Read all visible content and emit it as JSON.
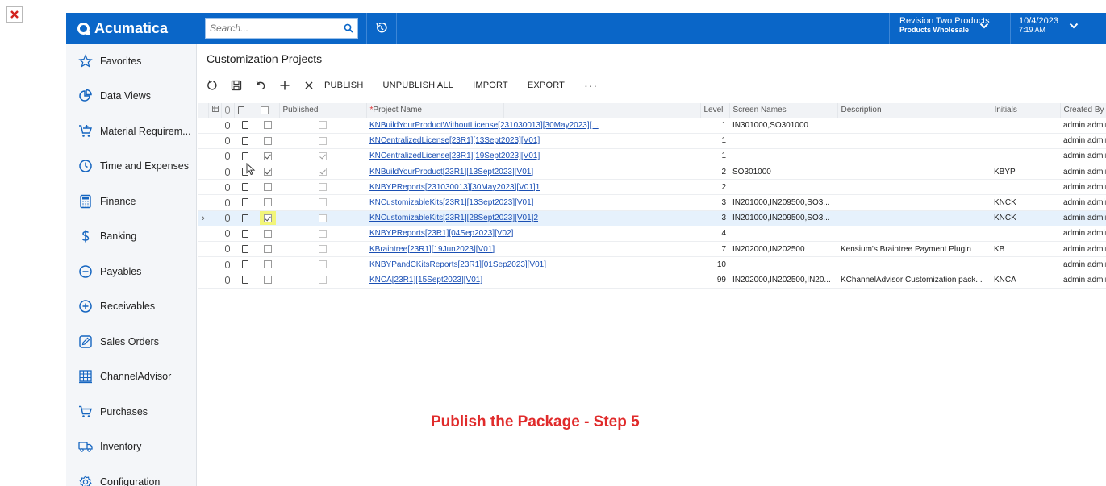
{
  "header": {
    "logo": "Acumatica",
    "search_placeholder": "Search...",
    "tenant_name": "Revision Two Products",
    "tenant_sub": "Products Wholesale",
    "date": "10/4/2023",
    "time": "7:19 AM"
  },
  "sidebar": {
    "items": [
      {
        "label": "Favorites",
        "icon": "star-icon"
      },
      {
        "label": "Data Views",
        "icon": "pie-chart-icon"
      },
      {
        "label": "Material Requirem...",
        "icon": "cart-plus-icon"
      },
      {
        "label": "Time and Expenses",
        "icon": "clock-icon"
      },
      {
        "label": "Finance",
        "icon": "calculator-icon"
      },
      {
        "label": "Banking",
        "icon": "dollar-icon"
      },
      {
        "label": "Payables",
        "icon": "minus-circle-icon"
      },
      {
        "label": "Receivables",
        "icon": "plus-circle-icon"
      },
      {
        "label": "Sales Orders",
        "icon": "pencil-icon"
      },
      {
        "label": "ChannelAdvisor",
        "icon": "grid-icon"
      },
      {
        "label": "Purchases",
        "icon": "cart-icon"
      },
      {
        "label": "Inventory",
        "icon": "truck-icon"
      },
      {
        "label": "Configuration",
        "icon": "gear-icon"
      }
    ]
  },
  "main": {
    "title": "Customization Projects",
    "toolbar": {
      "publish": "PUBLISH",
      "unpublish_all": "UNPUBLISH ALL",
      "import": "IMPORT",
      "export": "EXPORT",
      "more": "···"
    },
    "columns": {
      "published": "Published",
      "project_name": "Project Name",
      "required_mark": "*",
      "level": "Level",
      "screen_names": "Screen Names",
      "description": "Description",
      "initials": "Initials",
      "created_by": "Created By"
    },
    "rows": [
      {
        "name": "KNBuildYourProductWithoutLicense[231030013][30May2023][...",
        "level": "1",
        "screens": "IN301000,SO301000",
        "desc": "",
        "initials": "",
        "created_by": "admin admin",
        "selected": false,
        "published": false
      },
      {
        "name": "KNCentralizedLicense[23R1][13Sept2023][V01]",
        "level": "1",
        "screens": "",
        "desc": "",
        "initials": "",
        "created_by": "admin admin",
        "selected": false,
        "published": false
      },
      {
        "name": "KNCentralizedLicense[23R1][19Sept2023][V01]",
        "level": "1",
        "screens": "",
        "desc": "",
        "initials": "",
        "created_by": "admin admin",
        "selected": true,
        "published": true
      },
      {
        "name": "KNBuildYourProduct[23R1][13Sept2023][V01]",
        "level": "2",
        "screens": "SO301000",
        "desc": "",
        "initials": "KBYP",
        "created_by": "admin admin",
        "selected": true,
        "published": true
      },
      {
        "name": "KNBYPReports[231030013][30May2023][V01]1",
        "level": "2",
        "screens": "",
        "desc": "",
        "initials": "",
        "created_by": "admin admin",
        "selected": false,
        "published": false
      },
      {
        "name": "KNCustomizableKits[23R1][13Sept2023][V01]",
        "level": "3",
        "screens": "IN201000,IN209500,SO3...",
        "desc": "",
        "initials": "KNCK",
        "created_by": "admin admin",
        "selected": false,
        "published": false
      },
      {
        "name": "KNCustomizableKits[23R1][28Sept2023][V01]2",
        "level": "3",
        "screens": "IN201000,IN209500,SO3...",
        "desc": "",
        "initials": "KNCK",
        "created_by": "admin admin",
        "selected": true,
        "published": false,
        "active": true
      },
      {
        "name": "KNBYPReports[23R1][04Sep2023][V02]",
        "level": "4",
        "screens": "",
        "desc": "",
        "initials": "",
        "created_by": "admin admin",
        "selected": false,
        "published": false
      },
      {
        "name": "KBraintree[23R1][19Jun2023][V01]",
        "level": "7",
        "screens": "IN202000,IN202500",
        "desc": "Kensium's Braintree Payment Plugin",
        "initials": "KB",
        "created_by": "admin admin",
        "selected": false,
        "published": false
      },
      {
        "name": "KNBYPandCKitsReports[23R1][01Sep2023][V01]",
        "level": "10",
        "screens": "",
        "desc": "",
        "initials": "",
        "created_by": "admin admin",
        "selected": false,
        "published": false
      },
      {
        "name": "KNCA[23R1][15Sept2023][V01]",
        "level": "99",
        "screens": "IN202000,IN202500,IN20...",
        "desc": "KChannelAdvisor Customization pack...",
        "initials": "KNCA",
        "created_by": "admin admin",
        "selected": false,
        "published": false
      }
    ]
  },
  "caption": "Publish the Package - Step 5",
  "colors": {
    "header_blue": "#0a66c8",
    "caption_red": "#e02b2b",
    "highlight": "#f2f57a"
  }
}
